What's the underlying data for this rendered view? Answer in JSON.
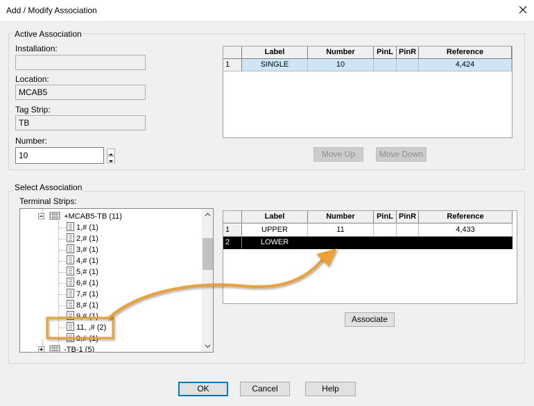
{
  "window": {
    "title": "Add / Modify Association",
    "close_glyph": "✕"
  },
  "active": {
    "group_label": "Active Association",
    "installation_label": "Installation:",
    "installation_value": "",
    "location_label": "Location:",
    "location_value": "MCAB5",
    "tagstrip_label": "Tag Strip:",
    "tagstrip_value": "TB",
    "number_label": "Number:",
    "number_value": "10",
    "grid": {
      "columns": [
        "",
        "Label",
        "Number",
        "PinL",
        "PinR",
        "Reference"
      ],
      "rows": [
        {
          "index": "1",
          "label": "SINGLE",
          "number": "10",
          "pinl": "",
          "pinr": "",
          "reference": "4,424"
        }
      ]
    },
    "move_up_label": "Move Up",
    "move_down_label": "Move Down"
  },
  "select": {
    "group_label": "Select Association",
    "terminal_strips_label": "Terminal Strips:",
    "tree": {
      "parent": "+MCAB5-TB (11)",
      "children": [
        "1,# (1)",
        "2,# (1)",
        "3,# (1)",
        "4,# (1)",
        "5,# (1)",
        "6,# (1)",
        "7,# (1)",
        "8,# (1)",
        "9,# (1)",
        "11, ,# (2)",
        "9,# (1)"
      ],
      "next_parent": "-TB-1 (5)"
    },
    "grid": {
      "columns": [
        "",
        "Label",
        "Number",
        "PinL",
        "PinR",
        "Reference"
      ],
      "rows": [
        {
          "index": "1",
          "label": "UPPER",
          "number": "11",
          "pinl": "",
          "pinr": "",
          "reference": "4,433"
        },
        {
          "index": "2",
          "label": "LOWER",
          "number": "",
          "pinl": "",
          "pinr": "",
          "reference": ""
        }
      ]
    },
    "associate_label": "Associate"
  },
  "footer": {
    "ok_label": "OK",
    "cancel_label": "Cancel",
    "help_label": "Help"
  },
  "colors": {
    "accent": "#0078d7",
    "callout": "#f0a030",
    "selected_row": "#cce6f7"
  }
}
